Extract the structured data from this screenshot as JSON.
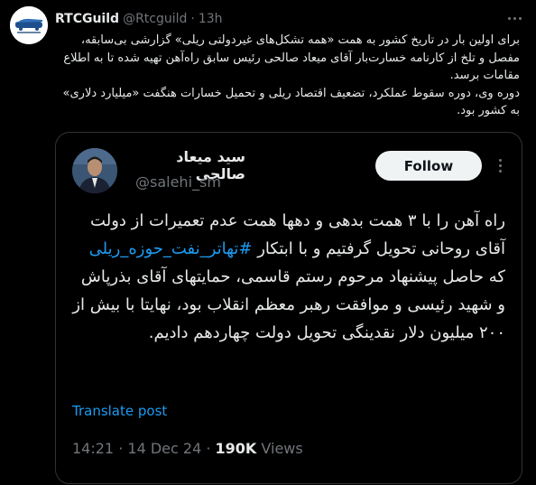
{
  "outer_tweet": {
    "display_name": "RTCGuild",
    "handle": "@Rtcguild",
    "separator": "·",
    "time": "13h",
    "paragraph_1": "برای اولین بار در تاریخ کشور به همت «همه تشکل‌های غیردولتی ریلی» گزارشی بی‌سابقه، مفصل و تلخ از کارنامه خسارت‌بار آقای میعاد صالحی رئیس سابق راه‌آهن تهیه شده تا به اطلاع مقامات برسد.",
    "paragraph_2": "دوره وی، دوره سقوط عملکرد، تضعیف اقتصاد ریلی و تحمیل خسارات هنگفت «میلیارد دلاری» به کشور بود."
  },
  "quoted_tweet": {
    "display_name": "سید میعاد صالحی",
    "handle": "@salehi_sm",
    "follow_label": "Follow",
    "text_before_hashtag": "راه آهن را با ۳ همت بدهی و دهها همت عدم تعمیرات از دولت آقای روحانی تحویل گرفتیم و با ابتکار ",
    "hashtag": "#تهاتر_نفت_حوزه_ریلی",
    "text_after_hashtag": " که حاصل پیشنهاد مرحوم رستم قاسمی، حمایتهای آقای بذرپاش و شهید رئیسی و موافقت رهبر معظم انقلاب بود، نهایتا با بیش از ۲۰۰ میلیون دلار نقدینگی تحویل دولت چهاردهم دادیم.",
    "translate_label": "Translate post",
    "time": "14:21",
    "date": "14 Dec 24",
    "dot": "·",
    "views_count": "190K",
    "views_label": "Views"
  }
}
